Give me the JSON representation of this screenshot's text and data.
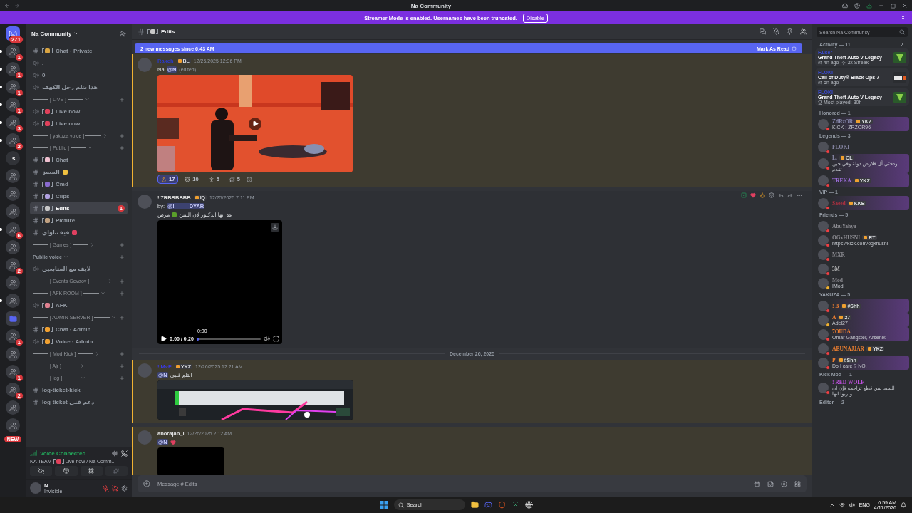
{
  "titlebar": {
    "title": "Na Community"
  },
  "banner": {
    "text": "Streamer Mode is enabled. Usernames have been truncated.",
    "button": "Disable"
  },
  "servers": [
    {
      "kind": "home",
      "badge": "271",
      "unread": false
    },
    {
      "kind": "avatar",
      "badge": "1",
      "unread": true
    },
    {
      "kind": "avatar",
      "badge": "1",
      "unread": true
    },
    {
      "kind": "avatar",
      "badge": "1",
      "unread": true
    },
    {
      "kind": "avatar",
      "badge": "1",
      "unread": true
    },
    {
      "kind": "avatar",
      "badge": "3",
      "unread": true
    },
    {
      "kind": "avatar",
      "badge": "2",
      "unread": true
    },
    {
      "kind": "text",
      "label": ".s",
      "unread": false
    },
    {
      "kind": "avatar",
      "unread": false
    },
    {
      "kind": "avatar",
      "unread": false
    },
    {
      "kind": "avatar",
      "unread": false
    },
    {
      "kind": "avatar",
      "badge": "6",
      "unread": true
    },
    {
      "kind": "avatar",
      "unread": false
    },
    {
      "kind": "avatar",
      "badge": "2",
      "unread": false
    },
    {
      "kind": "avatar",
      "unread": false
    },
    {
      "kind": "avatar",
      "unread": true
    },
    {
      "kind": "folder",
      "unread": false
    },
    {
      "kind": "avatar",
      "badge": "1",
      "unread": false
    },
    {
      "kind": "avatar",
      "unread": false
    },
    {
      "kind": "avatar",
      "badge": "1",
      "unread": false
    },
    {
      "kind": "avatar",
      "badge": "2",
      "unread": false
    },
    {
      "kind": "avatar",
      "unread": false
    },
    {
      "kind": "avatar",
      "unread": false
    }
  ],
  "new_badge": "NEW",
  "server_name": "Na Community",
  "sections": [
    {
      "channels": [
        {
          "kind": "text",
          "color": "#d9a441",
          "name": "Chat · Private",
          "selected": false
        },
        {
          "kind": "voice",
          "name": ".",
          "selected": false
        },
        {
          "kind": "voice",
          "name": "0",
          "selected": false
        },
        {
          "kind": "voice",
          "name": "هذا يتلم رجل الكهف",
          "selected": false
        }
      ]
    },
    {
      "title": "[ LIVE ]",
      "kind": "line",
      "expanded": true,
      "channels": [
        {
          "kind": "voice",
          "color": "#e0405a",
          "name": "Live now",
          "selected": false
        },
        {
          "kind": "voice",
          "color": "#e0405a",
          "name": "Live now",
          "selected": false
        }
      ]
    },
    {
      "title": "[ yakuza voice ]",
      "kind": "line",
      "expanded": false
    },
    {
      "title": "[ Public ]",
      "kind": "line",
      "expanded": true,
      "channels": [
        {
          "kind": "text",
          "color": "#f0c0d0",
          "name": "Chat",
          "selected": false
        },
        {
          "kind": "suffixed",
          "color": "#f0c040",
          "name": "الميمز",
          "selected": false
        },
        {
          "kind": "text",
          "color": "#8a6ad0",
          "name": "Cmd",
          "selected": false
        },
        {
          "kind": "text",
          "color": "#b0a0e0",
          "name": "Clips",
          "selected": false
        },
        {
          "kind": "text",
          "color": "#c8c8c8",
          "name": "Edits",
          "selected": true,
          "badge": "1"
        },
        {
          "kind": "text",
          "color": "#c0a080",
          "name": "Picture",
          "selected": false
        },
        {
          "kind": "suffixed",
          "color": "#e04060",
          "name": "قيف-اواي",
          "selected": false
        }
      ]
    },
    {
      "title": "[ Games ]",
      "kind": "line",
      "expanded": false
    },
    {
      "title": "Public voice",
      "kind": "plain",
      "expanded": true,
      "channels": [
        {
          "kind": "voice",
          "name": "لايف مع المتابعين",
          "selected": false
        }
      ]
    },
    {
      "title": "[ Events Gevaoy ]",
      "kind": "line",
      "expanded": false
    },
    {
      "title": "[ AFK ROOM ]",
      "kind": "line",
      "expanded": true,
      "channels": [
        {
          "kind": "voice",
          "color": "#e08090",
          "name": "AFK",
          "selected": false
        }
      ]
    },
    {
      "title": "[ ADMIN SERVER ]",
      "kind": "line",
      "expanded": true,
      "channels": [
        {
          "kind": "text",
          "color": "#f0a030",
          "name": "Chat · Admin",
          "selected": false
        },
        {
          "kind": "voice",
          "color": "#f0a030",
          "name": "Voice · Admin",
          "selected": false
        }
      ]
    },
    {
      "title": "[ Mod Kick ]",
      "kind": "line",
      "expanded": false
    },
    {
      "title": "[ Ajr ]",
      "kind": "line",
      "expanded": false
    },
    {
      "title": "[ log ]",
      "kind": "line",
      "expanded": true,
      "channels": [
        {
          "kind": "text",
          "name": "log-ticket-kick",
          "selected": false
        },
        {
          "kind": "text",
          "name": "log-ticket-دعم-فني",
          "selected": false
        }
      ]
    }
  ],
  "voice": {
    "status": "Voice Connected",
    "team": "NA TEAM",
    "color": "#e0405a",
    "channel": "Live now / Na Comm..."
  },
  "user": {
    "name": "N",
    "status": "Invisible"
  },
  "channel_header": {
    "name": "Edits",
    "color": "#c8c8c8"
  },
  "search": {
    "placeholder": "Search Na Community"
  },
  "new_messages": {
    "text": "2 new messages since 6:43 AM",
    "action": "Mark As Read"
  },
  "messages": [
    {
      "kind": "message",
      "author": "Rakeh",
      "color": "#2a3ad0",
      "tag": "BL",
      "time": "12/25/2025 12:36 PM",
      "highlighted": true,
      "hovered": false,
      "lines": [
        {
          "kind": "ltr",
          "parts": [
            {
              "kind": "text",
              "text": "Na"
            },
            {
              "kind": "mention",
              "text": "@N"
            },
            {
              "kind": "edited",
              "text": "(edited)"
            }
          ]
        }
      ],
      "attachment": {
        "kind": "scene_video"
      },
      "reactions": [
        {
          "kind": "fire",
          "count": "17",
          "selected": true
        },
        {
          "kind": "animal",
          "count": "10",
          "selected": false
        },
        {
          "kind": "figure",
          "count": "5",
          "selected": false
        },
        {
          "kind": "swap",
          "count": "5",
          "selected": false
        }
      ]
    },
    {
      "kind": "message",
      "author": "! 7RBBBBBB",
      "color": "#e0e0e0",
      "tag": "IQ",
      "time": "12/25/2025 7:11 PM",
      "highlighted": false,
      "hovered": true,
      "lines": [
        {
          "kind": "ltr",
          "parts": [
            {
              "kind": "text",
              "text": "by:"
            },
            {
              "kind": "mention",
              "text": "@!          DYAR"
            }
          ]
        },
        {
          "kind": "rtl",
          "parts": [
            {
              "kind": "text",
              "text": "عد ايها الدكتور لان التنين"
            },
            {
              "kind": "dragon"
            },
            {
              "kind": "text",
              "text": "مرض"
            }
          ]
        }
      ],
      "attachment": {
        "kind": "player",
        "hover_time": "0:00",
        "time": "0:00 / 0:20",
        "level": 0
      }
    },
    {
      "kind": "divider",
      "text": "December 26, 2025"
    },
    {
      "kind": "message",
      "author": "! MvP",
      "color": "#3a3ae0",
      "tag": "YKZ",
      "time": "12/26/2025 12:21 AM",
      "highlighted": true,
      "hovered": false,
      "lines": [
        {
          "kind": "ltr",
          "parts": [
            {
              "kind": "mention",
              "text": "@N"
            },
            {
              "kind": "text",
              "text": "التلم قلبي"
            }
          ]
        }
      ],
      "attachment": {
        "kind": "stream_picture"
      }
    },
    {
      "kind": "message",
      "author": "aborajab_l",
      "color": "#e0e0e0",
      "time": "12/26/2025 2:12 AM",
      "highlighted": true,
      "hovered": false,
      "lines": [
        {
          "kind": "ltr",
          "parts": [
            {
              "kind": "mention",
              "text": "@N"
            },
            {
              "kind": "heart"
            }
          ]
        }
      ],
      "attachment": {
        "kind": "black_frame"
      }
    }
  ],
  "composer": {
    "placeholder": "Message # Edits"
  },
  "members": {
    "activity_title": "Activity — 11",
    "cards": [
      {
        "user": "F.user",
        "game": "Grand Theft Auto V Legacy",
        "kind": "gta",
        "meta": [
          {
            "kind": "time",
            "text": "4h ago"
          },
          {
            "kind": "streak",
            "text": "3x Streak"
          }
        ]
      },
      {
        "user": "FLOKI",
        "game": "Call of Duty® Black Ops 7",
        "kind": "cod",
        "meta": [
          {
            "kind": "time",
            "text": "5h ago"
          }
        ]
      },
      {
        "user": "FLOKI",
        "game": "Grand Theft Auto V Legacy",
        "kind": "gta",
        "meta": [
          {
            "kind": "trophy",
            "text": "Most played: 30h"
          }
        ]
      }
    ],
    "groups": [
      {
        "title": "Honored — 1",
        "members": [
          {
            "name": "ZdRzOR",
            "color": "#8a8ab0",
            "idle": false,
            "tag": "YKZ",
            "status": "KICK : ZRZOR96",
            "nameplate": true
          }
        ]
      },
      {
        "title": "Legends — 3",
        "members": [
          {
            "name": "FLOKI",
            "color": "#8a8aa8",
            "idle": false,
            "nameplate": false
          },
          {
            "name": "L.",
            "color": "#8a8aa8",
            "idle": false,
            "tag": "OL",
            "status": "ودختي آل قلارض دولة وفي حين تقدم",
            "nameplate": true
          },
          {
            "name": "TREKA",
            "color": "#a070e0",
            "idle": false,
            "tag": "YKZ",
            "nameplate": true
          }
        ]
      },
      {
        "title": "VIP — 1",
        "members": [
          {
            "name": "Saeed",
            "color": "#b03040",
            "idle": false,
            "tag": "KKB",
            "nameplate": true
          }
        ]
      },
      {
        "title": "Friends — 5",
        "members": [
          {
            "name": "AbuYahya",
            "color": "#8a8a90",
            "idle": false,
            "nameplate": false
          },
          {
            "name": "OGxHUSNI",
            "color": "#8a8a90",
            "idle": false,
            "tag": "RT",
            "status": "https://kick.com/ogxhusni",
            "nameplate": false
          },
          {
            "name": "MXR",
            "color": "#8a8a90",
            "idle": false,
            "nameplate": false
          },
          {
            "name": "3M",
            "color": "#d0d0d0",
            "idle": false,
            "nameplate": false
          },
          {
            "name": "Mod",
            "color": "#8a8a90",
            "idle": true,
            "status": "IMod",
            "nameplate": false
          }
        ]
      },
      {
        "title": "YAKUZA — 5",
        "members": [
          {
            "name": "! B",
            "color": "#f08030",
            "idle": false,
            "tag": "#Shh",
            "nameplate": true
          },
          {
            "name": "A",
            "color": "#f08030",
            "idle": true,
            "tag": "27",
            "status": "Adel27",
            "nameplate": true
          },
          {
            "name": "7OUDA",
            "color": "#f08030",
            "idle": false,
            "status": "Omar Gangster, Arsenik",
            "nameplate": true
          },
          {
            "name": "ABUNAJJAR",
            "color": "#f08030",
            "idle": false,
            "tag": "YKZ",
            "nameplate": false
          },
          {
            "name": "P",
            "color": "#f08030",
            "idle": false,
            "tag": "#Shh",
            "status": "Do I care ? NO.",
            "nameplate": true
          }
        ]
      },
      {
        "title": "Kick Mod — 1",
        "members": [
          {
            "name": "! RED WOLF",
            "color": "#c050e0",
            "idle": false,
            "status": "السيد لمن قطع تزاحمه فإن ان ولربوا انها",
            "nameplate": false
          }
        ]
      },
      {
        "title": "Editor — 2"
      }
    ]
  },
  "taskbar": {
    "search": "Search",
    "language": "ENG",
    "time": "6:59 AM",
    "date": "4/17/2026"
  }
}
